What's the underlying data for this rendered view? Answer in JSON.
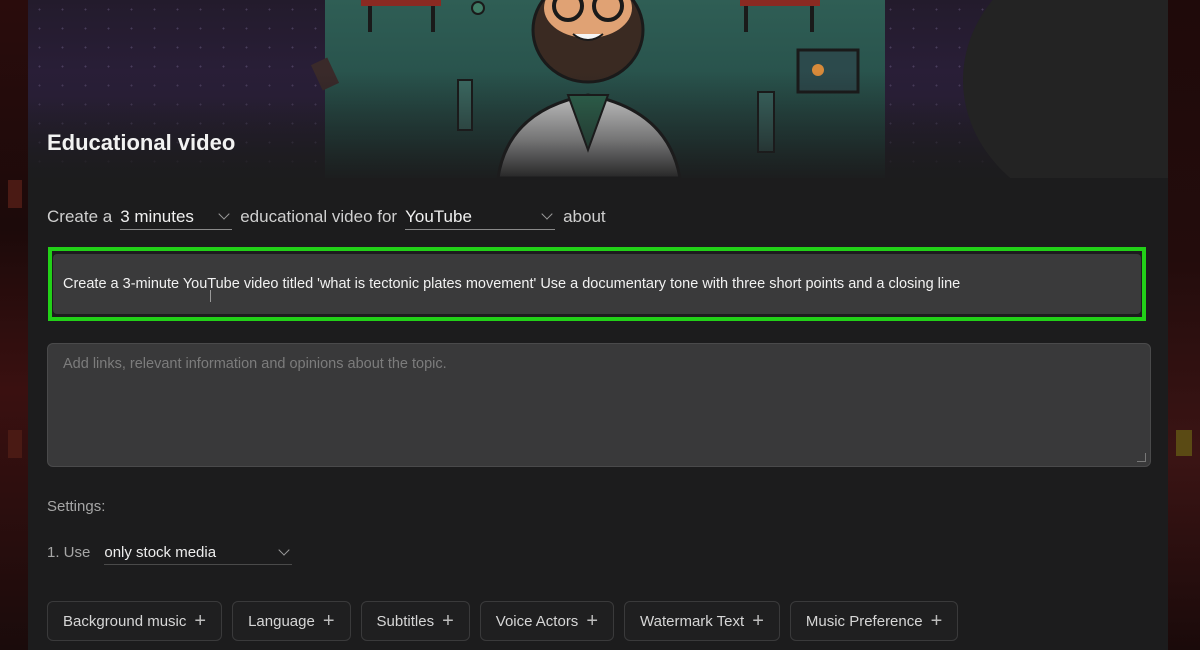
{
  "card": {
    "title": "Educational video",
    "prompt": {
      "create": "Create a",
      "duration": "3 minutes",
      "middle": "educational video for",
      "platform": "YouTube",
      "about": "about"
    },
    "topic_value": "Create a 3-minute YouTube video titled 'what is tectonic plates movement' Use a documentary tone with three short points and a closing line",
    "details_placeholder": "Add links, relevant information and opinions about the topic.",
    "settings_label": "Settings:",
    "use_label": "1. Use",
    "media_option": "only stock media",
    "chips": [
      "Background music",
      "Language",
      "Subtitles",
      "Voice Actors",
      "Watermark Text",
      "Music Preference"
    ],
    "chip_plus": "+"
  },
  "colors": {
    "highlight": "#22d018",
    "panel": "#1c1c1d",
    "input": "#3a3a3b"
  },
  "icons": [
    "chevron-down-icon",
    "plus-icon",
    "text-cursor-icon"
  ]
}
